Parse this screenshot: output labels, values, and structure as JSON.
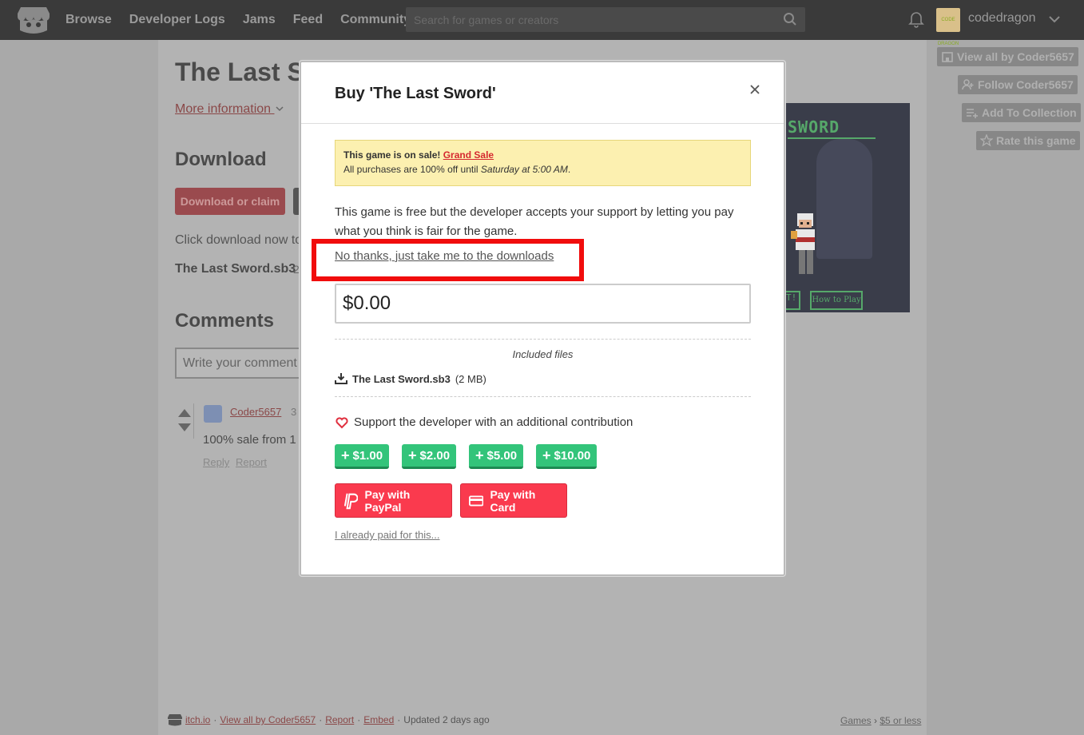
{
  "topbar": {
    "nav": [
      "Browse",
      "Developer Logs",
      "Jams",
      "Feed",
      "Community"
    ],
    "search_placeholder": "Search for games or creators",
    "username": "codedragon",
    "avatar_text": "CODE DRAGON"
  },
  "page": {
    "title": "The Last Sv",
    "more_info": "More information",
    "download_heading": "Download",
    "download_button": "Download or claim",
    "click_text": "Click download now to",
    "file_name": "The Last Sword.sb3",
    "file_size_partial": "2",
    "comments_heading": "Comments",
    "comment_placeholder": "Write your comment",
    "comment": {
      "user": "Coder5657",
      "time_partial": "3",
      "text": "100% sale from 1",
      "reply": "Reply",
      "report": "Report"
    }
  },
  "screenshot": {
    "title": "SWORD",
    "btn1": "T!",
    "btn2": "How to Play"
  },
  "side_actions": {
    "view_all": "View all by Coder5657",
    "follow": "Follow Coder5657",
    "add_collection": "Add To Collection",
    "rate": "Rate this game"
  },
  "footer": {
    "site": "itch.io",
    "view_all": "View all by Coder5657",
    "report": "Report",
    "embed": "Embed",
    "updated": "Updated 2 days ago",
    "games": "Games",
    "price_filter": "$5 or less",
    "sep": "·",
    "chevron": "›"
  },
  "modal": {
    "title": "Buy 'The Last Sword'",
    "sale_prefix": "This game is on sale!",
    "sale_link": "Grand Sale",
    "sale_line2_prefix": "All purchases are 100% off until",
    "sale_until": "Saturday at 5:00 AM",
    "sale_period": ".",
    "free_text": "This game is free but the developer accepts your support by letting you pay what you think is fair for the game.",
    "no_thanks": "No thanks, just take me to the downloads",
    "price_value": "$0.00",
    "included_files": "Included files",
    "file_name": "The Last Sword.sb3",
    "file_size": "(2 MB)",
    "support_text": "Support the developer with an additional contribution",
    "tips": [
      "$1.00",
      "$2.00",
      "$5.00",
      "$10.00"
    ],
    "pay_paypal": "Pay with PayPal",
    "pay_card": "Pay with Card",
    "already_paid": "I already paid for this...",
    "plus_glyph": "+"
  },
  "colors": {
    "accent_red": "#fa3a4e",
    "tip_green": "#33c47a",
    "sale_yellow": "#fcf0b0",
    "highlight_red": "#f10c0c"
  }
}
